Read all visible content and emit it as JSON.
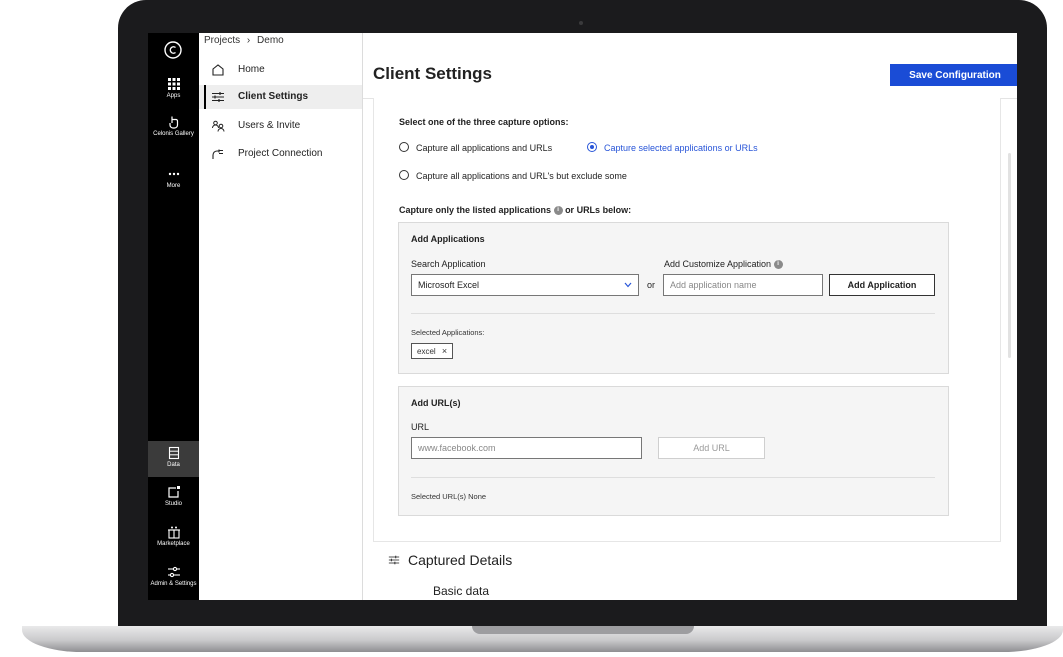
{
  "breadcrumb": {
    "root": "Projects",
    "separator": "›",
    "current": "Demo"
  },
  "icon_rail": {
    "logo_icon": "celonis-logo-icon",
    "top_items": [
      {
        "label": "Apps",
        "icon": "grid-icon"
      },
      {
        "label": "Celonis Gallery",
        "icon": "hand-pointer-icon"
      },
      {
        "label": "More",
        "icon": "ellipsis-icon"
      }
    ],
    "bottom_items": [
      {
        "label": "Data",
        "icon": "database-icon"
      },
      {
        "label": "Studio",
        "icon": "studio-icon"
      },
      {
        "label": "Marketplace",
        "icon": "gift-icon"
      },
      {
        "label": "Admin & Settings",
        "icon": "sliders-icon"
      }
    ]
  },
  "left_nav": {
    "items": [
      {
        "label": "Home",
        "icon": "home-icon"
      },
      {
        "label": "Client Settings",
        "icon": "settings-sliders-icon",
        "active": true
      },
      {
        "label": "Users & Invite",
        "icon": "users-icon"
      },
      {
        "label": "Project Connection",
        "icon": "plug-icon"
      }
    ]
  },
  "header": {
    "title": "Client Settings",
    "save_label": "Save Configuration"
  },
  "capture": {
    "prompt": "Select one of the three capture options:",
    "options": [
      {
        "label": "Capture all applications and URLs",
        "selected": false
      },
      {
        "label": "Capture selected applications or URLs",
        "selected": true
      },
      {
        "label": "Capture all applications and URL's but exclude some",
        "selected": false
      }
    ],
    "listed_heading_prefix": "Capture only the listed applications",
    "listed_heading_suffix": "or URLs below:"
  },
  "add_applications": {
    "title": "Add Applications",
    "search_label": "Search Application",
    "search_value": "Microsoft Excel",
    "or_label": "or",
    "customize_label": "Add Customize Application",
    "customize_placeholder": "Add application name",
    "add_button": "Add Application",
    "selected_label": "Selected Applications:",
    "selected_items": [
      "excel"
    ]
  },
  "add_urls": {
    "title": "Add URL(s)",
    "url_label": "URL",
    "url_placeholder": "www.facebook.com",
    "add_button": "Add URL",
    "selected_text": "Selected URL(s) None"
  },
  "captured_details": {
    "title": "Captured Details",
    "subsection": "Basic data"
  },
  "colors": {
    "accent": "#1a4cd6",
    "rail": "#000000",
    "panel": "#f5f5f5"
  }
}
